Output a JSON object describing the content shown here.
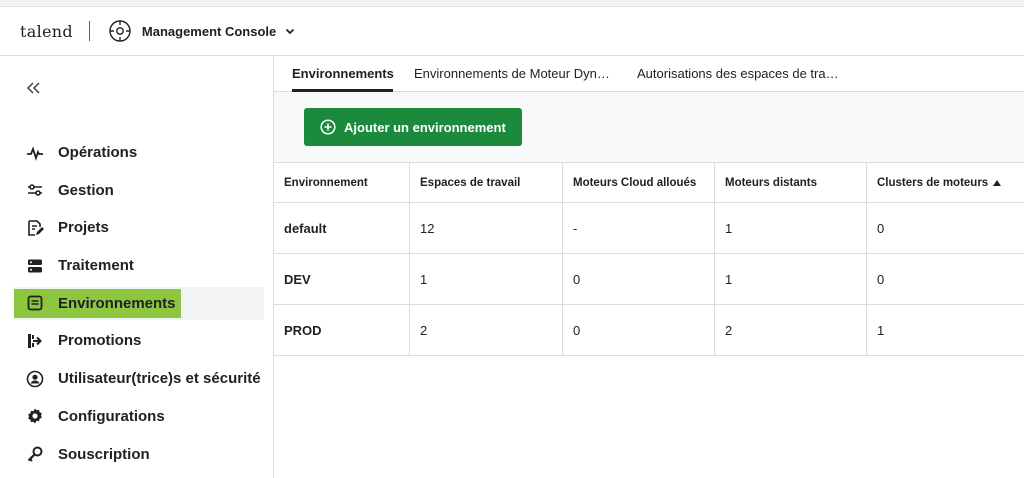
{
  "header": {
    "logo": "talend",
    "app_title": "Management Console"
  },
  "sidebar": {
    "collapse_icon": "double-chevron-left-icon",
    "items": [
      {
        "label": "Opérations",
        "icon": "activity-icon"
      },
      {
        "label": "Gestion",
        "icon": "sliders-icon"
      },
      {
        "label": "Projets",
        "icon": "edit-document-icon"
      },
      {
        "label": "Traitement",
        "icon": "server-icon"
      },
      {
        "label": "Environnements",
        "icon": "environment-icon",
        "active": true
      },
      {
        "label": "Promotions",
        "icon": "promotion-icon"
      },
      {
        "label": "Utilisateur(trice)s et sécurité",
        "icon": "user-circle-icon"
      },
      {
        "label": "Configurations",
        "icon": "gear-icon"
      },
      {
        "label": "Souscription",
        "icon": "key-icon"
      }
    ]
  },
  "tabs": [
    {
      "label": "Environnements",
      "active": true
    },
    {
      "label": "Environnements de Moteur Dyn…"
    },
    {
      "label": "Autorisations des espaces de tra…"
    }
  ],
  "toolbar": {
    "add_label": "Ajouter un environnement"
  },
  "table": {
    "headers": [
      "Environnement",
      "Espaces de travail",
      "Moteurs Cloud alloués",
      "Moteurs distants",
      "Clusters de moteurs"
    ],
    "rows": [
      [
        "default",
        "12",
        "-",
        "1",
        "0"
      ],
      [
        "DEV",
        "1",
        "0",
        "1",
        "0"
      ],
      [
        "PROD",
        "2",
        "0",
        "2",
        "1"
      ]
    ]
  },
  "colors": {
    "accent_green": "#1b8a3c",
    "active_highlight": "#8dc63f"
  }
}
